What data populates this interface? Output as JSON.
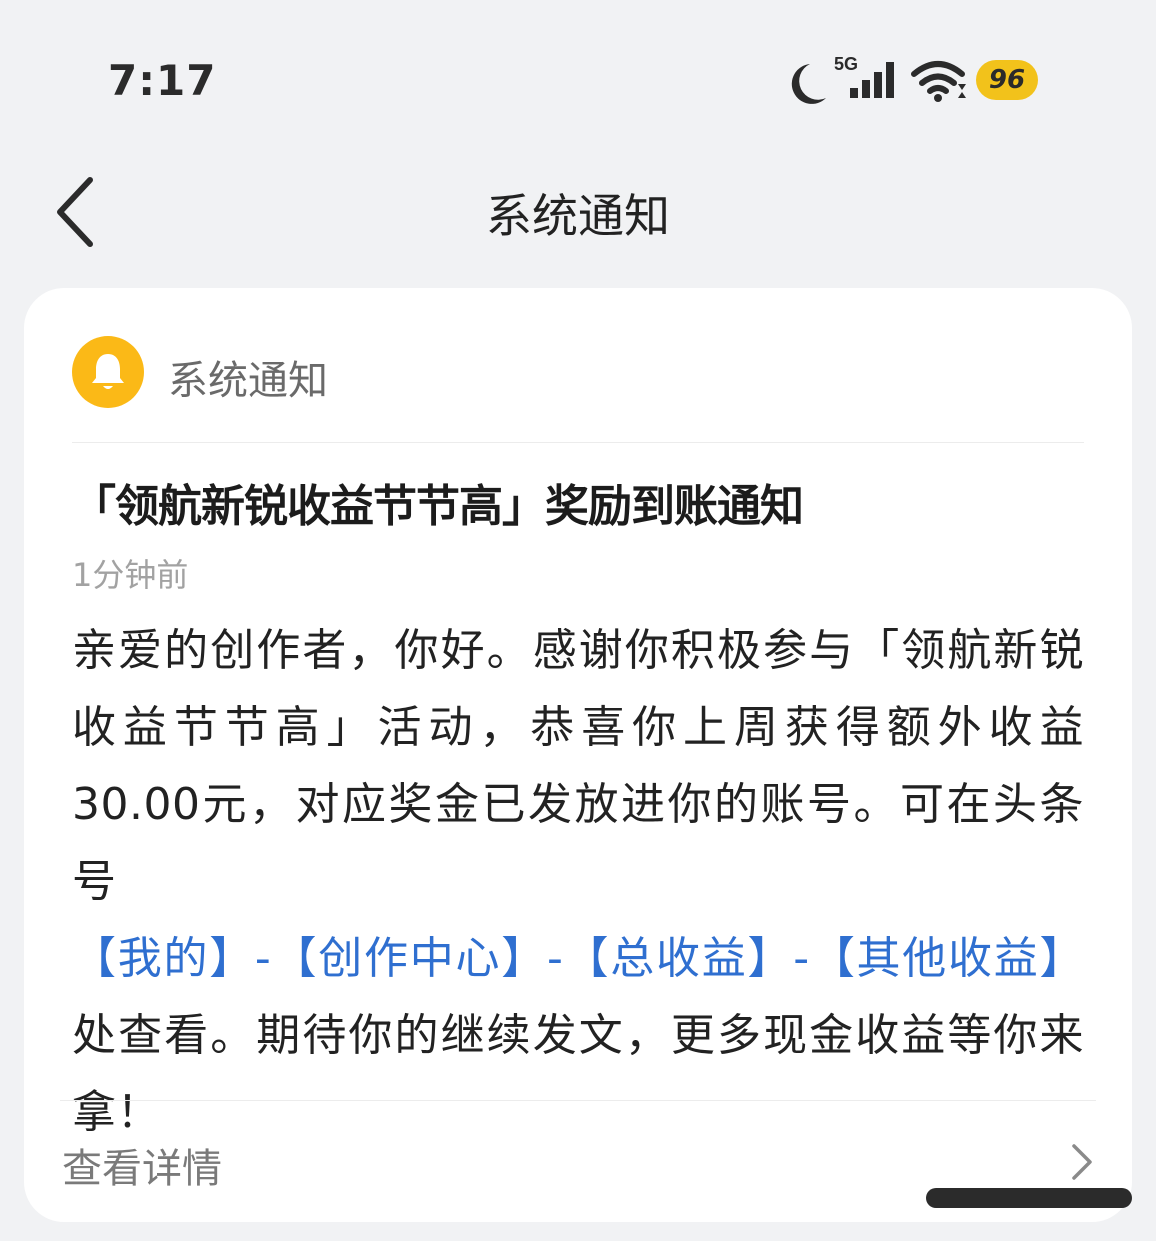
{
  "status_bar": {
    "time": "7:17",
    "network": "5G",
    "battery": "96"
  },
  "nav": {
    "title": "系统通知"
  },
  "card": {
    "header_label": "系统通知",
    "title": "「领航新锐收益节节高」奖励到账通知",
    "time": "1分钟前",
    "body_parts": [
      {
        "text": "亲爱的创作者，你好。感谢你积极参与「领航新锐收益节节高」活动，恭喜你上周获得额外收益30.00元，对应奖金已发放进你的账号。可在头条号",
        "link": false
      },
      {
        "text": "【我的】-【创作中心】-【总收益】-【其他收益】",
        "link": true
      },
      {
        "text": "处查看。期待你的继续发文，更多现金收益等你来拿！",
        "link": false
      }
    ],
    "details_label": "查看详情"
  }
}
